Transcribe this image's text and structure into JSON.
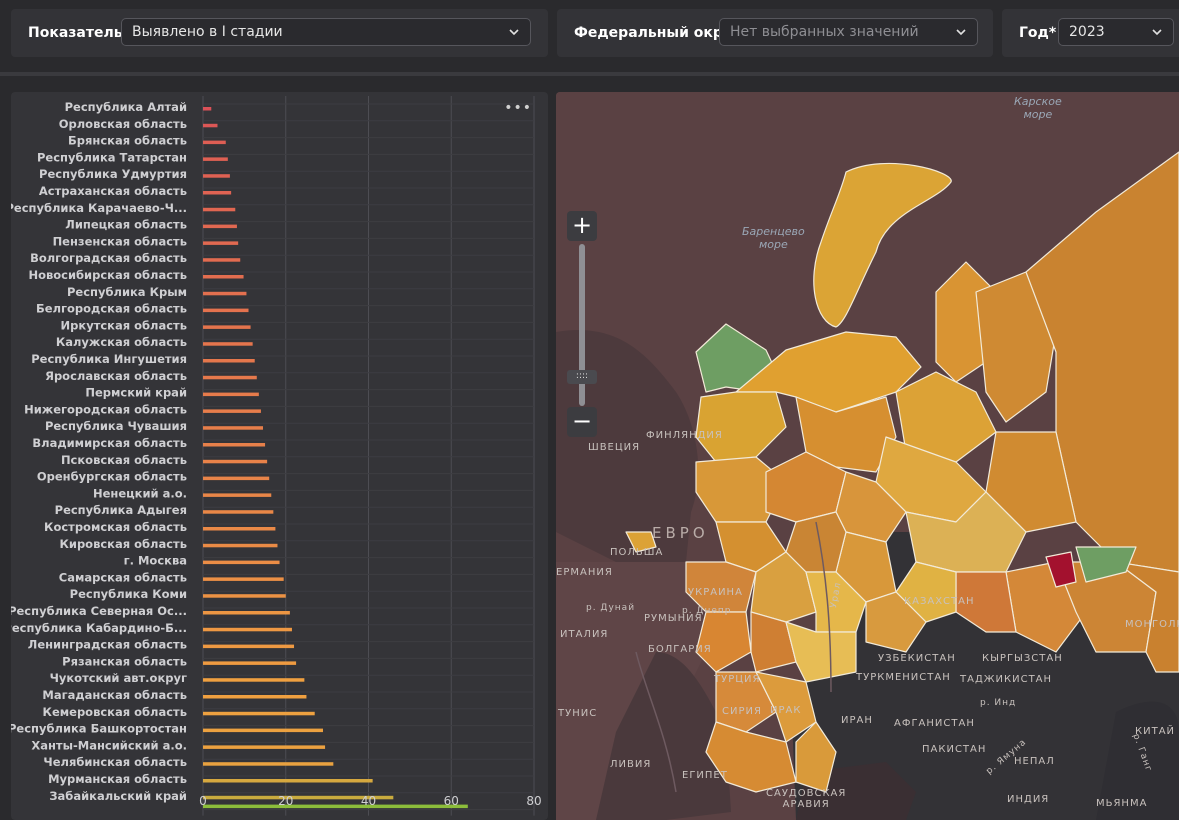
{
  "filters": {
    "indicator": {
      "label": "Показатель*",
      "value": "Выявлено в I стадии"
    },
    "district": {
      "label": "Федеральный округ",
      "placeholder": "Нет выбранных значений"
    },
    "year": {
      "label": "Год*",
      "value": "2023"
    }
  },
  "chart_data": {
    "type": "bar",
    "orientation": "horizontal",
    "categories": [
      "Республика Алтай",
      "Орловская область",
      "Брянская область",
      "Республика Татарстан",
      "Республика Удмуртия",
      "Астраханская область",
      "Республика Карачаево-Ч...",
      "Липецкая область",
      "Пензенская область",
      "Волгоградская область",
      "Новосибирская область",
      "Республика Крым",
      "Белгородская область",
      "Иркутская область",
      "Калужская область",
      "Республика Ингушетия",
      "Ярославская область",
      "Пермский край",
      "Нижегородская область",
      "Республика Чувашия",
      "Владимирская область",
      "Псковская область",
      "Оренбургская область",
      "Ненецкий а.о.",
      "Республика Адыгея",
      "Костромская область",
      "Кировская область",
      "г. Москва",
      "Самарская область",
      "Республика Коми",
      "Республика Северная Ос...",
      "Республика Кабардино-Б...",
      "Ленинградская область",
      "Рязанская область",
      "Чукотский авт.округ",
      "Магаданская область",
      "Кемеровская область",
      "Республика Башкортостан",
      "Ханты-Мансийский а.о.",
      "Челябинская область",
      "Мурманская область",
      "Забайкальский край"
    ],
    "values": [
      2,
      3.5,
      5.5,
      6,
      6.5,
      6.8,
      7.8,
      8.2,
      8.5,
      9,
      9.8,
      10.5,
      11,
      11.5,
      12,
      12.5,
      13,
      13.5,
      14,
      14.5,
      15,
      15.5,
      16,
      16.5,
      17,
      17.5,
      18,
      18.5,
      19.5,
      20,
      21,
      21.5,
      22,
      22.5,
      24.5,
      25,
      27,
      29,
      29.5,
      31.5,
      41,
      46,
      64
    ],
    "xlim": [
      0,
      80
    ],
    "xticks": [
      "0",
      "20",
      "40",
      "60",
      "80"
    ],
    "grid": true,
    "colors": {
      "low": "#d94a5a",
      "mid": "#f0a040",
      "high": "#7cc23a"
    }
  },
  "chart": {
    "menu_label": "•••"
  },
  "map": {
    "zoom_in": "+",
    "zoom_out": "−",
    "zoom_handle": "::::",
    "labels": {
      "kara_sea": "Карское\nморе",
      "barents_sea": "Баренцево\nморе",
      "finland": "ФИНЛЯНДИЯ",
      "sweden": "ШВЕЦИЯ",
      "poland": "ПОЛЬША",
      "germany": "ЕРМАНИЯ",
      "europe": "ЕВРО",
      "ukraine": "УКРАИНА",
      "romania": "РУМЫНИЯ",
      "bulgaria": "БОЛГАРИЯ",
      "italy": "ИТАЛИЯ",
      "turkey": "ТУРЦИЯ",
      "tunisia": "ТУНИС",
      "syria": "СИРИЯ",
      "iraq": "ИРАК",
      "iran": "ИРАН",
      "libya": "ЛИВИЯ",
      "egypt": "ЕГИПЕТ",
      "saudi": "САУДОВСКАЯ\nАРАВИЯ",
      "kazakhstan": "КАЗАХСТАН",
      "uzbekistan": "УЗБЕКИСТАН",
      "kyrgyzstan": "КЫРГЫЗСТАН",
      "turkmenistan": "ТУРКМЕНИСТАН",
      "tajikistan": "ТАДЖИКИСТАН",
      "afghanistan": "АФГАНИСТАН",
      "pakistan": "ПАКИСТАН",
      "india": "ИНДИЯ",
      "nepal": "НЕПАЛ",
      "china": "КИТАЙ",
      "mongolia": "МОНГОЛИ",
      "myanmar": "МЬЯНМА",
      "dnipro": "р. Днепр",
      "danube": "р. Дунай",
      "ural": "Урал",
      "indus": "р. Инд",
      "ganges": "р. Ганг",
      "yamuna": "р. Ямуна"
    }
  }
}
